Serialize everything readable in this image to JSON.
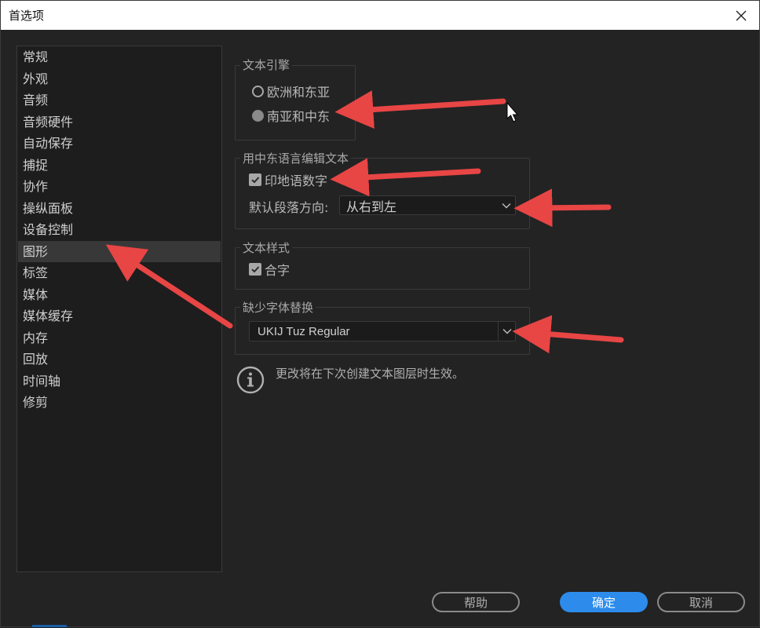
{
  "window": {
    "title": "首选项"
  },
  "sidebar": {
    "items": [
      {
        "label": "常规"
      },
      {
        "label": "外观"
      },
      {
        "label": "音频"
      },
      {
        "label": "音频硬件"
      },
      {
        "label": "自动保存"
      },
      {
        "label": "捕捉"
      },
      {
        "label": "协作"
      },
      {
        "label": "操纵面板"
      },
      {
        "label": "设备控制"
      },
      {
        "label": "图形"
      },
      {
        "label": "标签"
      },
      {
        "label": "媒体"
      },
      {
        "label": "媒体缓存"
      },
      {
        "label": "内存"
      },
      {
        "label": "回放"
      },
      {
        "label": "时间轴"
      },
      {
        "label": "修剪"
      }
    ],
    "selected": "图形"
  },
  "text_engine": {
    "legend": "文本引擎",
    "option_1": "欧洲和东亚",
    "option_2": "南亚和中东",
    "selected": "南亚和中东"
  },
  "middle_east": {
    "legend": "用中东语言编辑文本",
    "hindi_digits_label": "印地语数字",
    "hindi_digits_checked": true,
    "direction_label": "默认段落方向:",
    "direction_value": "从右到左"
  },
  "text_style": {
    "legend": "文本样式",
    "ligatures_label": "合字",
    "ligatures_checked": true
  },
  "missing_font": {
    "legend": "缺少字体替换",
    "font_value": "UKIJ Tuz Regular"
  },
  "note": {
    "text": "更改将在下次创建文本图层时生效。"
  },
  "footer": {
    "help_label": "帮助",
    "ok_label": "确定",
    "cancel_label": "取消"
  },
  "colors": {
    "accent": "#2d8ceb",
    "annotation_arrow": "#e84545",
    "background": "#232323",
    "selection": "#383838"
  }
}
